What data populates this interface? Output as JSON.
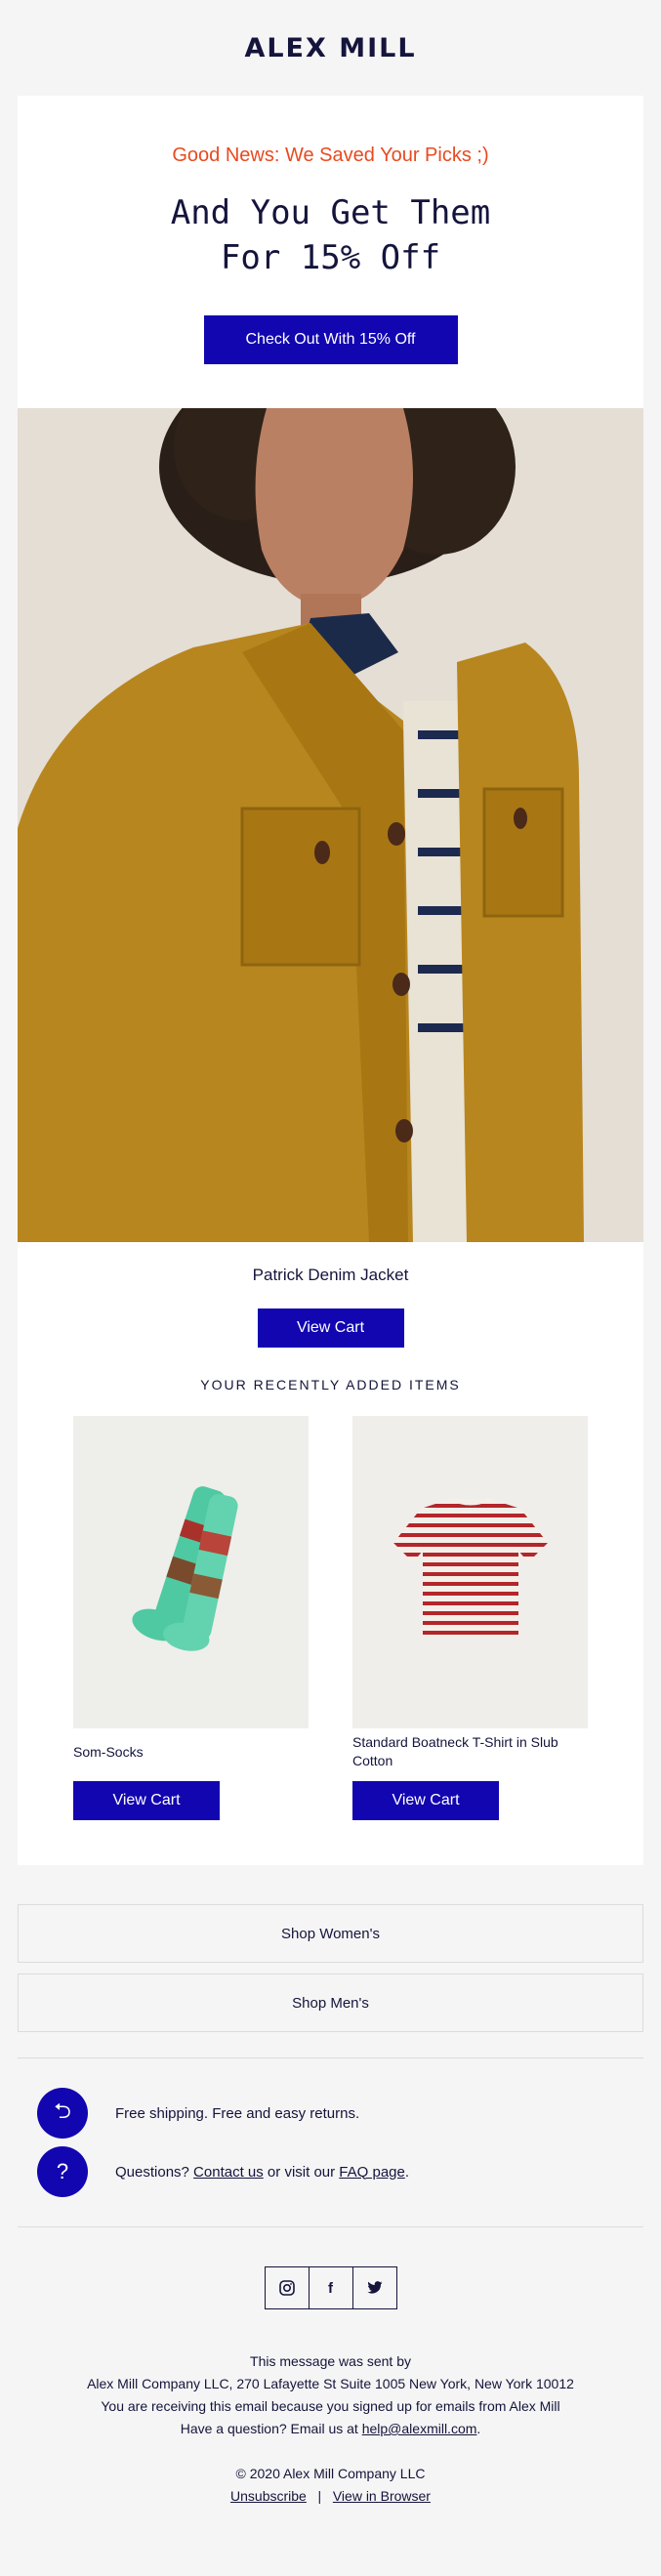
{
  "brand": {
    "logo_text": "ALEX MILL"
  },
  "hero": {
    "subtitle": "Good News: We Saved Your Picks ;)",
    "title_line1": "And You Get Them",
    "title_line2": "For 15% Off",
    "cta_label": "Check Out With 15% Off"
  },
  "featured": {
    "name": "Patrick Denim Jacket",
    "cta_label": "View Cart"
  },
  "recent": {
    "heading": "YOUR RECENTLY ADDED ITEMS",
    "items": [
      {
        "name": "Som-Socks",
        "cta_label": "View Cart"
      },
      {
        "name": "Standard Boatneck T-Shirt in Slub Cotton",
        "cta_label": "View Cart"
      }
    ]
  },
  "shop": {
    "women_label": "Shop Women's",
    "men_label": "Shop Men's"
  },
  "benefits": {
    "shipping_text": "Free shipping. Free and easy returns.",
    "questions_prefix": "Questions? ",
    "contact_link": "Contact us",
    "questions_middle": " or visit our ",
    "faq_link": "FAQ page",
    "questions_suffix": "."
  },
  "social": {
    "icons": [
      "instagram-icon",
      "facebook-icon",
      "twitter-icon"
    ]
  },
  "footer": {
    "line1": "This message was sent by",
    "line2": "Alex Mill Company LLC, 270 Lafayette St Suite 1005 New York, New York 10012",
    "line3": "You are receiving this email because you signed up for emails from Alex Mill",
    "question_prefix": "Have a question? Email us at ",
    "email": "help@alexmill.com",
    "question_suffix": ".",
    "copyright": "© 2020 Alex Mill Company LLC",
    "unsubscribe": "Unsubscribe",
    "separator": "|",
    "view_browser": "View in Browser"
  },
  "colors": {
    "accent": "#1206b0",
    "promo": "#e84a1f",
    "text": "#14143c",
    "background": "#f5f5f5"
  }
}
